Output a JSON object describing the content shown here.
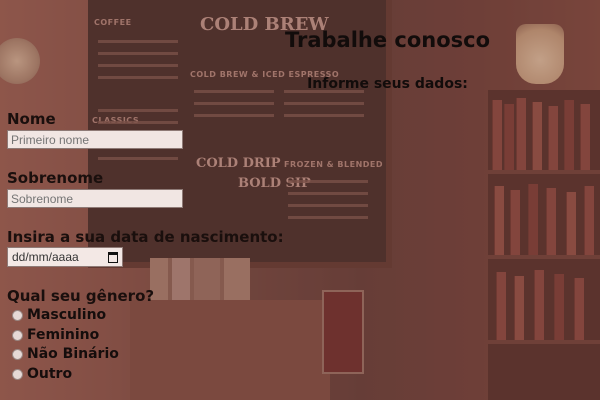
{
  "page": {
    "title": "Trabalhe conosco",
    "subtitle": "Informe seus dados:"
  },
  "fields": {
    "first_name": {
      "label": "Nome",
      "placeholder": "Primeiro nome"
    },
    "last_name": {
      "label": "Sobrenome",
      "placeholder": "Sobrenome"
    },
    "birthdate": {
      "label": "Insira a sua data de nascimento:",
      "value_display": "dd/mm/aaaa",
      "icon": "calendar-icon"
    }
  },
  "gender": {
    "label": "Qual seu gênero?",
    "options": [
      "Masculino",
      "Feminino",
      "Não Binário",
      "Outro"
    ]
  },
  "background": {
    "board_headers": [
      "COFFEE",
      "COLD BREW",
      "COLD BREW & ICED ESPRESSO",
      "CLASSICS",
      "FROZEN & BLENDED",
      "COLD DRIP",
      "BOLD SIP"
    ]
  },
  "colors": {
    "text": "#120c0b",
    "tint": "#965a50",
    "input_bg": "#f1e6e3"
  }
}
